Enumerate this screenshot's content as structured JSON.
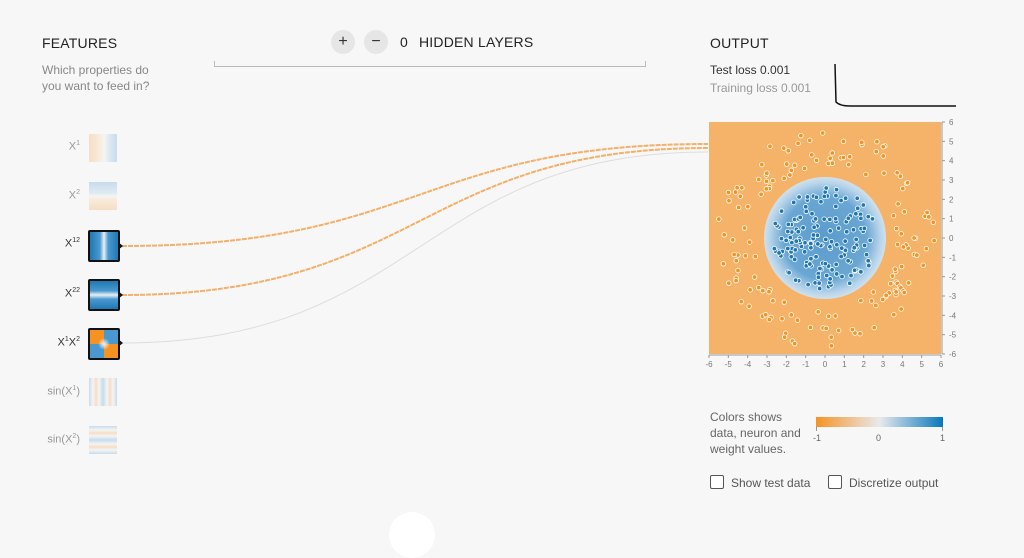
{
  "features_panel": {
    "title": "FEATURES",
    "subtitle_line1": "Which properties do",
    "subtitle_line2": "you want to feed in?",
    "items": [
      {
        "base": "X",
        "sup": "1",
        "active": false
      },
      {
        "base": "X",
        "sup": "2",
        "active": false
      },
      {
        "base": "X",
        "sup": "12",
        "active": true
      },
      {
        "base": "X",
        "sup": "22",
        "active": true
      },
      {
        "base": "X",
        "sup": "1",
        "base2": "X",
        "sup2": "2",
        "active": true
      },
      {
        "base": "sin(X",
        "sup": "1",
        "tail": ")",
        "active": false
      },
      {
        "base": "sin(X",
        "sup": "2",
        "tail": ")",
        "active": false
      }
    ]
  },
  "hidden_layers": {
    "add_label": "+",
    "remove_label": "−",
    "count": "0",
    "label": "HIDDEN LAYERS"
  },
  "output_panel": {
    "title": "OUTPUT",
    "test_loss_label": "Test loss",
    "test_loss_value": "0.001",
    "training_loss_label": "Training loss",
    "training_loss_value": "0.001",
    "x_ticks": [
      "-6",
      "-5",
      "-4",
      "-3",
      "-2",
      "-1",
      "0",
      "1",
      "2",
      "3",
      "4",
      "5",
      "6"
    ],
    "y_ticks": [
      "6",
      "5",
      "4",
      "3",
      "2",
      "1",
      "0",
      "-1",
      "-2",
      "-3",
      "-4",
      "-5",
      "-6"
    ]
  },
  "legend": {
    "text_line1": "Colors shows",
    "text_line2": "data, neuron and",
    "text_line3": "weight values.",
    "min": "-1",
    "mid": "0",
    "max": "1",
    "color_negative": "#f59322",
    "color_neutral": "#e8eaeb",
    "color_positive": "#0877bd"
  },
  "options": {
    "show_test_data": "Show test data",
    "discretize_output": "Discretize output"
  }
}
